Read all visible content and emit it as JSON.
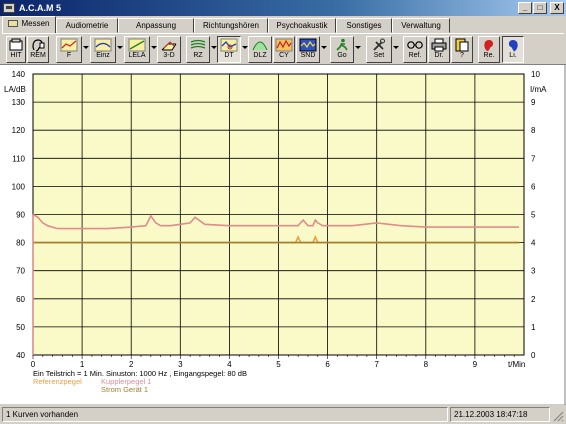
{
  "window": {
    "title": "A.C.A.M 5",
    "minimize": "_",
    "maximize": "□",
    "close": "X"
  },
  "tabs": [
    {
      "label": "Messen",
      "active": true
    },
    {
      "label": "Audiometrie"
    },
    {
      "label": "Anpassung"
    },
    {
      "label": "Richtungshören"
    },
    {
      "label": "Psychoakustik"
    },
    {
      "label": "Sonstiges"
    },
    {
      "label": "Verwaltung"
    }
  ],
  "toolbar": [
    {
      "label": "HIT",
      "icon": "hit-device-icon"
    },
    {
      "label": "REM",
      "icon": "rem-ear-icon"
    },
    {
      "label": "F",
      "icon": "frequency-curve-icon"
    },
    {
      "label": "Einz",
      "icon": "single-curve-icon"
    },
    {
      "label": "LELA",
      "icon": "lela-curve-icon"
    },
    {
      "label": "3-D",
      "icon": "three-d-icon"
    },
    {
      "label": "RZ",
      "icon": "rz-icon"
    },
    {
      "label": "DT",
      "icon": "dt-curve-icon",
      "pressed": true
    },
    {
      "label": "DLZ",
      "icon": "dlz-icon"
    },
    {
      "label": "CY",
      "icon": "cy-icon"
    },
    {
      "label": "SND",
      "icon": "snd-icon"
    },
    {
      "label": "Go",
      "icon": "go-runner-icon"
    },
    {
      "label": "Set",
      "icon": "set-tools-icon"
    },
    {
      "label": "Ref.",
      "icon": "reference-glasses-icon"
    },
    {
      "label": "Dr.",
      "icon": "printer-icon"
    },
    {
      "label": "?",
      "icon": "help-icon"
    },
    {
      "label": "Re.",
      "icon": "right-ear-icon"
    },
    {
      "label": "Li.",
      "icon": "left-ear-icon"
    }
  ],
  "chart_data": {
    "type": "line",
    "xlabel": "t/Min",
    "ylabel_left": "LA/dB",
    "ylabel_right": "I/mA",
    "xlim": [
      0,
      10
    ],
    "ylim_left": [
      40,
      140
    ],
    "ylim_right": [
      0,
      10
    ],
    "x_ticks": [
      "0",
      "1",
      "2",
      "3",
      "4",
      "5",
      "6",
      "7",
      "8",
      "9"
    ],
    "y_ticks_left": [
      "140",
      "130",
      "120",
      "110",
      "100",
      "90",
      "80",
      "70",
      "60",
      "50",
      "40"
    ],
    "y_ticks_right": [
      "10",
      "9",
      "8",
      "7",
      "6",
      "5",
      "4",
      "3",
      "2",
      "1",
      "0"
    ],
    "grid": true,
    "background": "#fafac8",
    "annotation": "Ein Teilstrich = 1 Min.   Sinuston: 1000 Hz ,  Eingangspegel: 80 dB",
    "legend": [
      {
        "name": "Referenzpegel",
        "color": "#e8a040"
      },
      {
        "name": "Kupplerpegel 1",
        "color": "#e08ca0"
      },
      {
        "name": "Strom Gerät 1",
        "color": "#a08030"
      }
    ],
    "series": [
      {
        "name": "Kupplerpegel 1",
        "axis": "left",
        "color": "#e08c8c",
        "x": [
          0,
          0.1,
          0.2,
          0.3,
          0.5,
          1.0,
          1.5,
          2.0,
          2.3,
          2.4,
          2.5,
          2.6,
          2.8,
          3.0,
          3.2,
          3.3,
          3.5,
          4.0,
          4.5,
          5.0,
          5.4,
          5.5,
          5.6,
          5.7,
          5.75,
          5.8,
          5.9,
          6.0,
          6.5,
          7.0,
          7.5,
          8.0,
          8.5,
          9.0,
          9.5,
          9.9
        ],
        "y": [
          90,
          89,
          87,
          86,
          85,
          85,
          85,
          85.5,
          86,
          89.5,
          87,
          86,
          86,
          86.5,
          87,
          89,
          86.5,
          86,
          86,
          86,
          86,
          88,
          86,
          86,
          88,
          87,
          86,
          86,
          86,
          87,
          86,
          85.5,
          85.5,
          85.5,
          85.5,
          85.5
        ]
      },
      {
        "name": "Referenzpegel",
        "axis": "left",
        "color": "#e8a040",
        "x": [
          0,
          5.35,
          5.4,
          5.45,
          5.7,
          5.75,
          5.8,
          9.9
        ],
        "y": [
          80,
          80,
          82,
          80,
          80,
          82,
          80,
          80
        ]
      },
      {
        "name": "Strom Gerät 1",
        "axis": "right",
        "color": "#a08030",
        "x": [
          0,
          9.9
        ],
        "y": [
          4,
          4
        ]
      }
    ]
  },
  "status": {
    "left": "1 Kurven vorhanden",
    "right": "21.12.2003 18:47:18"
  }
}
